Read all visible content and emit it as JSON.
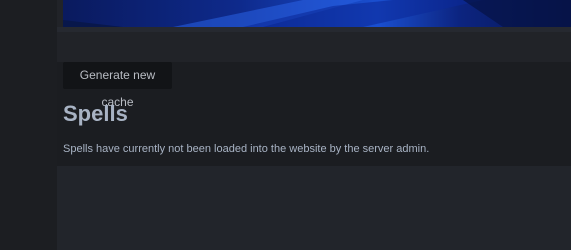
{
  "actions": {
    "generate_cache_label": "Generate new cache"
  },
  "page": {
    "title": "Spells",
    "notice": "Spells have currently not been loaded into the website by the server admin."
  },
  "colors": {
    "background": "#212328",
    "sidebar": "#1c1e22",
    "panel": "#1b1d21",
    "button_bg": "#121417",
    "text": "#a8b3c4",
    "banner_accent": "#1a4fd0"
  }
}
